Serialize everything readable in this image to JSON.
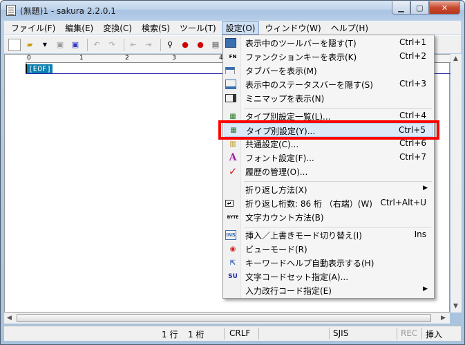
{
  "window": {
    "title": "(無題)1 - sakura 2.2.0.1"
  },
  "menubar": [
    "ファイル(F)",
    "編集(E)",
    "変換(C)",
    "検索(S)",
    "ツール(T)",
    "設定(O)",
    "ウィンドウ(W)",
    "ヘルプ(H)"
  ],
  "editor": {
    "eof": "[EOF]",
    "ruler_numbers": [
      "0",
      "1",
      "2",
      "3",
      "4"
    ]
  },
  "status": {
    "line": "1 行",
    "col": "1 桁",
    "eol": "CRLF",
    "encoding": "SJIS",
    "rec": "REC",
    "mode": "挿入"
  },
  "dropdown": {
    "items": [
      {
        "icon": "toolbar-icon",
        "label": "表示中のツールバーを隠す(T)",
        "shortcut": "Ctrl+1"
      },
      {
        "icon": "function-key-icon",
        "label": "ファンクションキーを表示(K)",
        "shortcut": "Ctrl+2"
      },
      {
        "icon": "tab-bar-icon",
        "label": "タブバーを表示(M)",
        "shortcut": ""
      },
      {
        "icon": "status-bar-icon",
        "label": "表示中のステータスバーを隠す(S)",
        "shortcut": "Ctrl+3"
      },
      {
        "icon": "minimap-icon",
        "label": "ミニマップを表示(N)",
        "shortcut": ""
      },
      {
        "icon": "type-list-icon",
        "label": "タイプ別設定一覧(L)...",
        "shortcut": "Ctrl+4"
      },
      {
        "icon": "type-settings-icon",
        "label": "タイプ別設定(Y)...",
        "shortcut": "Ctrl+5"
      },
      {
        "icon": "common-settings-icon",
        "label": "共通設定(C)...",
        "shortcut": "Ctrl+6"
      },
      {
        "icon": "font-icon",
        "label": "フォント設定(F)...",
        "shortcut": "Ctrl+7"
      },
      {
        "icon": "check-icon",
        "label": "履歴の管理(O)...",
        "shortcut": ""
      },
      {
        "icon": "",
        "label": "折り返し方法(X)",
        "shortcut": ""
      },
      {
        "icon": "wrap-icon",
        "label": "折り返し桁数: 86 桁 （右端）(W)",
        "shortcut": "Ctrl+Alt+U"
      },
      {
        "icon": "byte-icon",
        "label": "文字カウント方法(B)",
        "shortcut": ""
      },
      {
        "icon": "insert-icon",
        "label": "挿入／上書きモード切り替え(I)",
        "shortcut": "Ins"
      },
      {
        "icon": "view-mode-icon",
        "label": "ビューモード(R)",
        "shortcut": ""
      },
      {
        "icon": "keyword-help-icon",
        "label": "キーワードヘルプ自動表示する(H)",
        "shortcut": ""
      },
      {
        "icon": "charset-icon",
        "label": "文字コードセット指定(A)...",
        "shortcut": ""
      },
      {
        "icon": "",
        "label": "入力改行コード指定(E)",
        "shortcut": ""
      }
    ],
    "icon_glyphs": {
      "function-key-icon": "FN",
      "byte-icon": "BYTE",
      "insert-icon": "INS",
      "charset-icon": "SU",
      "font-icon": "A",
      "check-icon": "✓"
    }
  },
  "colors": {
    "highlight": "#ff0000",
    "eof_bg": "#0a7fb0"
  }
}
